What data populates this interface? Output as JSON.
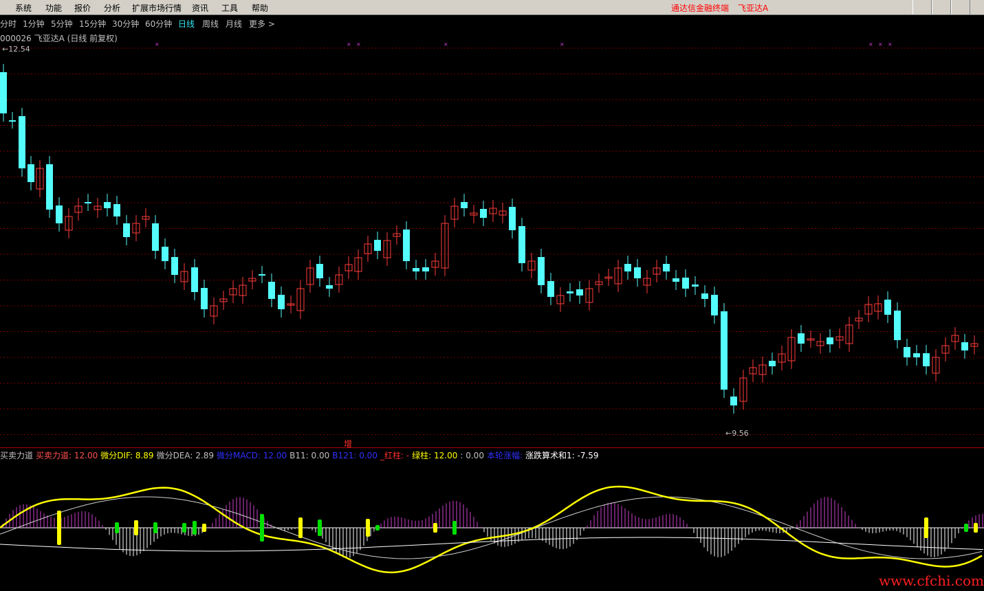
{
  "menubar": {
    "items": [
      "系统",
      "功能",
      "报价",
      "分析",
      "扩展市场行情",
      "资讯",
      "工具",
      "帮助"
    ],
    "brand": "通达信金融终端",
    "stock_brand": "飞亚达A"
  },
  "periods": {
    "items": [
      "分时",
      "1分钟",
      "5分钟",
      "15分钟",
      "30分钟",
      "60分钟",
      "日线",
      "周线",
      "月线",
      "更多 >"
    ],
    "active_index": 6
  },
  "chart": {
    "title": "000026 飞亚达A (日线 前复权)",
    "high_label": "12.54",
    "low_label": "9.56",
    "zeng_label": "增"
  },
  "colors": {
    "up": "#ff3c3c",
    "down": "#54fcfc",
    "grid": "#7a0000",
    "dif": "#ffff00",
    "dea": "#d0d0d0",
    "macd_pos": "#d040d0",
    "macd_neg": "#ffffff",
    "green_bar": "#00e000",
    "yellow_bar": "#ffff00"
  },
  "indicator": {
    "items": [
      {
        "text": "买卖力道",
        "color": "#c0c0c0"
      },
      {
        "text": "买卖力道: 12.00",
        "color": "#ff5050"
      },
      {
        "text": "微分DIF: 8.89",
        "color": "#ffff00"
      },
      {
        "text": "微分DEA: 2.89",
        "color": "#c0c0c0"
      },
      {
        "text": "微分MACD: 12.00",
        "color": "#3030ff"
      },
      {
        "text": "B11: 0.00",
        "color": "#c0c0c0"
      },
      {
        "text": "B121: 0.00",
        "color": "#3030ff"
      },
      {
        "text": "_红柱: -",
        "color": "#ff3030"
      },
      {
        "text": "绿柱: 12.00",
        "color": "#ffff00"
      },
      {
        "text": ": 0.00",
        "color": "#c0c0c0"
      },
      {
        "text": "本轮涨幅:",
        "color": "#3030ff"
      },
      {
        "text": "涨跌算术和1: -7.59",
        "color": "#ffffff"
      }
    ]
  },
  "watermark": "www.cfchi.com"
}
